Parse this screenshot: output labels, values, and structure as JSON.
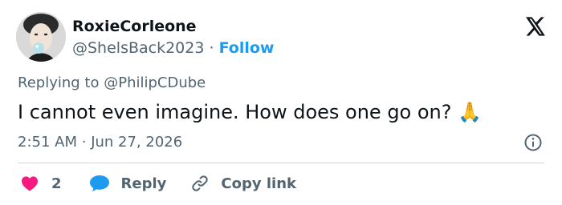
{
  "user": {
    "display_name": "RoxieCorleone",
    "handle": "@ShelsBack2023",
    "separator": "·",
    "follow_label": "Follow"
  },
  "tweet": {
    "replying_prefix": "Replying to",
    "replying_to": "@PhilipCDube",
    "text": "I cannot even imagine. How does one go on?",
    "emoji": "🙏",
    "time": "2:51 AM",
    "separator": "·",
    "date": "Jun 27, 2026"
  },
  "actions": {
    "like_count": "2",
    "reply_label": "Reply",
    "copy_link_label": "Copy link"
  },
  "colors": {
    "accent": "#1d9bf0",
    "like": "#f91880",
    "muted": "#536471",
    "text": "#0f1419"
  },
  "icons": [
    "avatar-photo",
    "x-logo-icon",
    "info-icon",
    "heart-icon",
    "reply-bubble-icon",
    "link-icon"
  ]
}
